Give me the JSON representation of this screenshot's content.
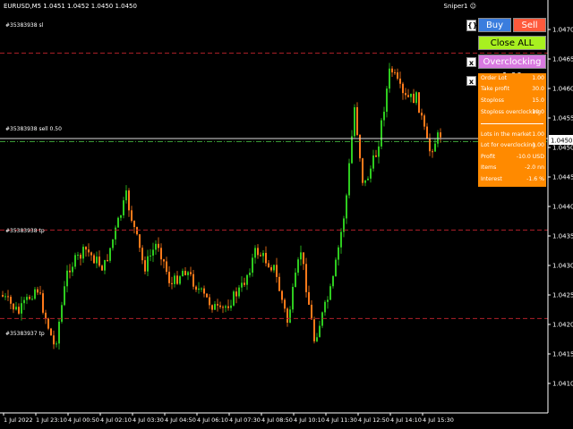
{
  "chart_header": {
    "symbol_info": "EURUSD,M5  1.0451 1.0452 1.0450 1.0450",
    "ea_label": "Sniper1",
    "ea_icon": "smiley-icon"
  },
  "orders": {
    "sl_label": "#35383938 sl",
    "sell_label": "#35383938 sell 0.50",
    "tp1_label": "#35383938 tp",
    "tp2_label": "#35383937 tp"
  },
  "price_axis": [
    "1.0470",
    "1.0465",
    "1.0460",
    "1.0455",
    "1.0450",
    "1.0445",
    "1.0440",
    "1.0435",
    "1.0430",
    "1.0425",
    "1.0420",
    "1.0415",
    "1.0410"
  ],
  "current_price": "1.0450",
  "time_axis": [
    "1 Jul 2022",
    "1 Jul 23:10",
    "4 Jul 00:50",
    "4 Jul 02:10",
    "4 Jul 03:30",
    "4 Jul 04:50",
    "4 Jul 06:10",
    "4 Jul 07:30",
    "4 Jul 08:50",
    "4 Jul 10:10",
    "4 Jul 11:30",
    "4 Jul 12:50",
    "4 Jul 14:10",
    "4 Jul 15:30"
  ],
  "buttons": {
    "toggle_icon": "brackets-icon",
    "buy": "Buy 1.00",
    "sell": "Sell 1.00",
    "close_all": "Close ALL",
    "overclocking": "Overclocking 1.00",
    "close_x": "x"
  },
  "panel": {
    "order_lot": {
      "k": "Order Lot",
      "v": "1.00"
    },
    "take_profit": {
      "k": "Take profit",
      "v": "30.0"
    },
    "stoploss": {
      "k": "Stoploss",
      "v": "15.0"
    },
    "stoploss_over": {
      "k": "Stoploss overclocking",
      "v": "10.0"
    },
    "lots_market": {
      "k": "Lots in the market",
      "v": "1.00"
    },
    "lot_over": {
      "k": "Lot for overclocking",
      "v": "1.00"
    },
    "profit": {
      "k": "Profit",
      "v": "-10.0 USD"
    },
    "items": {
      "k": "Items",
      "v": "-2.0 nn"
    },
    "interest": {
      "k": "Interest",
      "v": "-1.6 %"
    }
  },
  "colors": {
    "bull": "#2ecc1f",
    "bear": "#ff7a1a",
    "buy_btn": "#3a7dde",
    "sell_btn": "#ff5a3c",
    "close_btn": "#a8f020",
    "over_btn": "#d97ae0",
    "panel": "#ff8a00",
    "level_line": "#b0202a"
  },
  "chart_data": {
    "type": "candlestick",
    "y_range": [
      1.0405,
      1.0475
    ],
    "levels": {
      "sl": 1.0466,
      "sell": 1.0451,
      "tp1": 1.0436,
      "tp2": 1.0421
    }
  }
}
